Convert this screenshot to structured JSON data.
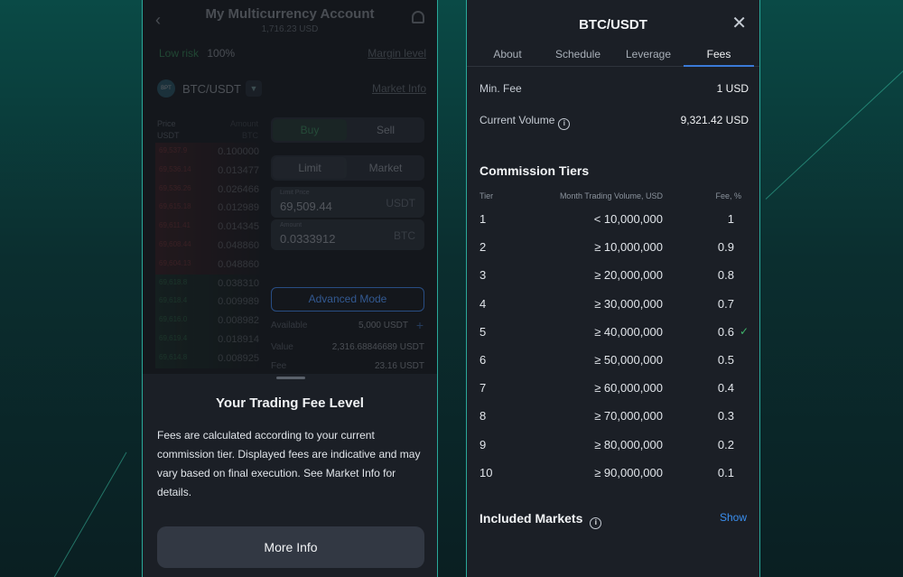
{
  "left": {
    "header": {
      "title": "My Multicurrency Account",
      "subtitle": "1,716.23 USD"
    },
    "risk": {
      "label": "Low risk",
      "value": "100%",
      "margin_link": "Margin level"
    },
    "pair": {
      "icon_text": "BPT",
      "name": "BTC/USDT",
      "market_info": "Market Info"
    },
    "orderbook_head": {
      "price": "Price",
      "price_unit": "USDT",
      "amount": "Amount",
      "amount_unit": "BTC"
    },
    "orderbook": [
      {
        "side": "ask",
        "price": "69,537.9",
        "amount": "0.100000"
      },
      {
        "side": "ask",
        "price": "69,536.14",
        "amount": "0.013477"
      },
      {
        "side": "ask",
        "price": "69,536.26",
        "amount": "0.026466"
      },
      {
        "side": "ask",
        "price": "69,615.18",
        "amount": "0.012989"
      },
      {
        "side": "ask",
        "price": "69,611.41",
        "amount": "0.014345"
      },
      {
        "side": "ask",
        "price": "69,608.44",
        "amount": "0.048860"
      },
      {
        "side": "ask",
        "price": "69,604.13",
        "amount": "0.048860"
      },
      {
        "side": "bid",
        "price": "69,618.8",
        "amount": "0.038310"
      },
      {
        "side": "bid",
        "price": "69,618.4",
        "amount": "0.009989"
      },
      {
        "side": "bid",
        "price": "69,616.0",
        "amount": "0.008982"
      },
      {
        "side": "bid",
        "price": "69,619.4",
        "amount": "0.018914"
      },
      {
        "side": "bid",
        "price": "69,614.8",
        "amount": "0.008925"
      }
    ],
    "trade": {
      "buy": "Buy",
      "sell": "Sell",
      "limit": "Limit",
      "market": "Market",
      "limit_price_label": "Limit Price",
      "limit_price_value": "69,509.44",
      "limit_price_unit": "USDT",
      "amount_label": "Amount",
      "amount_value": "0.0333912",
      "amount_unit": "BTC",
      "advanced": "Advanced Mode",
      "available_label": "Available",
      "available_value": "5,000 USDT",
      "value_label": "Value",
      "value_value": "2,316.68846689 USDT",
      "fee_label": "Fee",
      "fee_value": "23.16 USDT"
    },
    "sheet": {
      "title": "Your Trading Fee Level",
      "body": "Fees are calculated according to your current commission tier. Displayed fees are indicative and may vary based on final execution. See Market Info for details.",
      "button": "More Info"
    }
  },
  "right": {
    "title": "BTC/USDT",
    "tabs": [
      "About",
      "Schedule",
      "Leverage",
      "Fees"
    ],
    "min_fee_label": "Min. Fee",
    "min_fee_value": "1 USD",
    "volume_label": "Current Volume",
    "volume_value": "9,321.42 USD",
    "tiers_title": "Commission Tiers",
    "columns": {
      "tier": "Tier",
      "volume": "Month Trading Volume, USD",
      "fee": "Fee, %"
    },
    "tiers": [
      {
        "tier": "1",
        "volume": "< 10,000,000",
        "fee": "1"
      },
      {
        "tier": "2",
        "volume": "≥ 10,000,000",
        "fee": "0.9"
      },
      {
        "tier": "3",
        "volume": "≥ 20,000,000",
        "fee": "0.8"
      },
      {
        "tier": "4",
        "volume": "≥ 30,000,000",
        "fee": "0.7"
      },
      {
        "tier": "5",
        "volume": "≥ 40,000,000",
        "fee": "0.6",
        "current": true
      },
      {
        "tier": "6",
        "volume": "≥ 50,000,000",
        "fee": "0.5"
      },
      {
        "tier": "7",
        "volume": "≥ 60,000,000",
        "fee": "0.4"
      },
      {
        "tier": "8",
        "volume": "≥ 70,000,000",
        "fee": "0.3"
      },
      {
        "tier": "9",
        "volume": "≥ 80,000,000",
        "fee": "0.2"
      },
      {
        "tier": "10",
        "volume": "≥ 90,000,000",
        "fee": "0.1"
      }
    ],
    "included_title": "Included Markets",
    "show": "Show"
  }
}
